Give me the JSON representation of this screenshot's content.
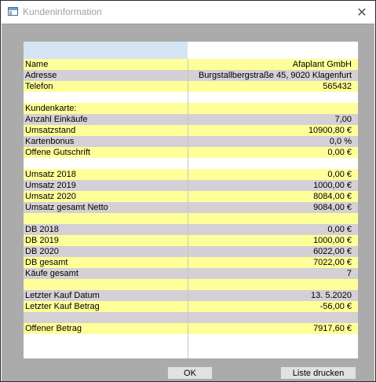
{
  "window": {
    "title": "Kundeninformation",
    "close_glyph": "✕"
  },
  "rows": [
    {
      "label": "Name",
      "value": "Afaplant GmbH",
      "color": "y"
    },
    {
      "label": "Adresse",
      "value": "Burgstallbergstraße 45, 9020 Klagenfurt",
      "color": "g"
    },
    {
      "label": "Telefon",
      "value": "565432",
      "color": "y"
    },
    {
      "label": "",
      "value": "",
      "color": "w"
    },
    {
      "label": "Kundenkarte:",
      "value": "",
      "color": "y"
    },
    {
      "label": "Anzahl Einkäufe",
      "value": "7,00",
      "color": "g"
    },
    {
      "label": "Umsatzstand",
      "value": "10900,80 €",
      "color": "y"
    },
    {
      "label": "Kartenbonus",
      "value": "0,0 %",
      "color": "g"
    },
    {
      "label": "Offene Gutschrift",
      "value": "0,00 €",
      "color": "y"
    },
    {
      "label": "",
      "value": "",
      "color": "w"
    },
    {
      "label": "Umsatz 2018",
      "value": "0,00 €",
      "color": "y"
    },
    {
      "label": "Umsatz 2019",
      "value": "1000,00 €",
      "color": "g"
    },
    {
      "label": "Umsatz 2020",
      "value": "8084,00 €",
      "color": "y"
    },
    {
      "label": "Umsatz gesamt Netto",
      "value": "9084,00 €",
      "color": "g"
    },
    {
      "label": "",
      "value": "",
      "color": "y"
    },
    {
      "label": "DB 2018",
      "value": "0,00 €",
      "color": "g"
    },
    {
      "label": "DB 2019",
      "value": "1000,00 €",
      "color": "y"
    },
    {
      "label": "DB 2020",
      "value": "6022,00 €",
      "color": "g"
    },
    {
      "label": "DB gesamt",
      "value": "7022,00 €",
      "color": "y"
    },
    {
      "label": "Käufe gesamt",
      "value": "7",
      "color": "g"
    },
    {
      "label": "",
      "value": "",
      "color": "y"
    },
    {
      "label": "Letzter Kauf Datum",
      "value": "13.  5.2020",
      "color": "g"
    },
    {
      "label": "Letzter Kauf Betrag",
      "value": "-56,00 €",
      "color": "y"
    },
    {
      "label": "",
      "value": "",
      "color": "g"
    },
    {
      "label": "Offener Betrag",
      "value": "7917,60 €",
      "color": "y"
    }
  ],
  "buttons": {
    "ok_label": "OK",
    "print_label": "Liste drucken"
  }
}
